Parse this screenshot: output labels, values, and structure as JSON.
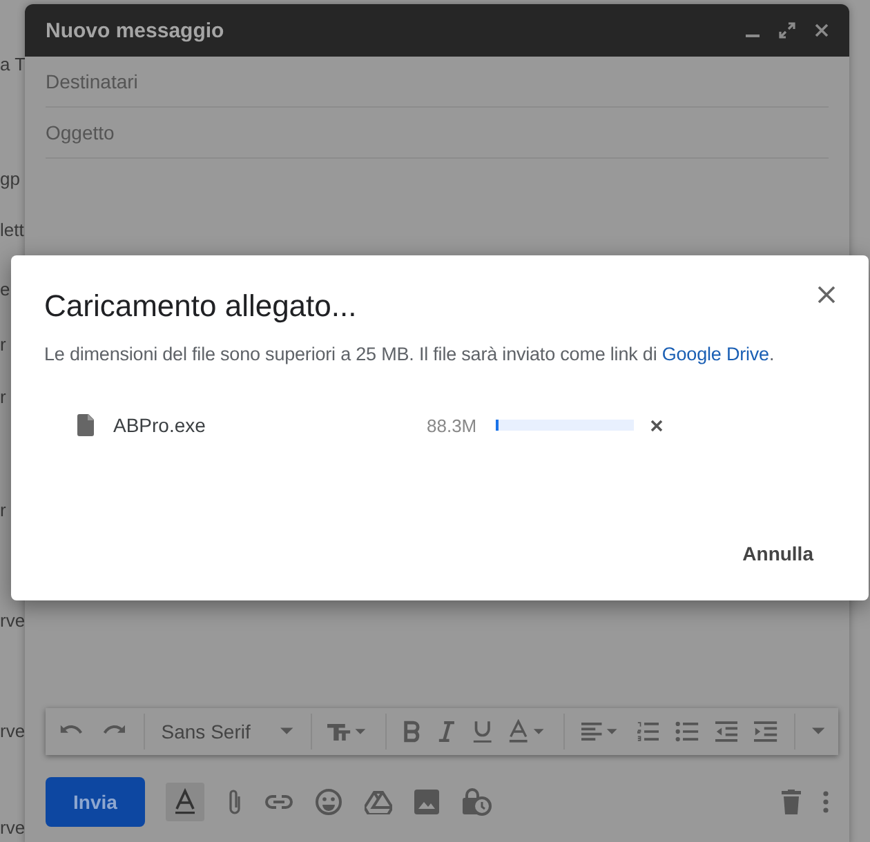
{
  "background_list": [
    {
      "text": "a T"
    },
    {
      "text": "gp"
    },
    {
      "text": "lett"
    },
    {
      "text": "e"
    },
    {
      "text": "r"
    },
    {
      "text": "r"
    },
    {
      "text": "r"
    },
    {
      "text": "rve"
    },
    {
      "text": "rve"
    },
    {
      "text": "rve"
    }
  ],
  "compose": {
    "title": "Nuovo messaggio",
    "fields": [
      {
        "placeholder": "Destinatari"
      },
      {
        "placeholder": "Oggetto"
      }
    ],
    "toolbar": {
      "font": "Sans Serif"
    },
    "send_button": "Invia"
  },
  "dialog": {
    "title": "Caricamento allegato...",
    "message": "Le dimensioni del file sono superiori a 25 MB. Il file sarà inviato come link di ",
    "link": "Google Drive",
    "message_end": ".",
    "file": {
      "name": "ABPro.exe",
      "size": "88.3M",
      "level": 0.02
    },
    "cancel": "Annulla"
  }
}
